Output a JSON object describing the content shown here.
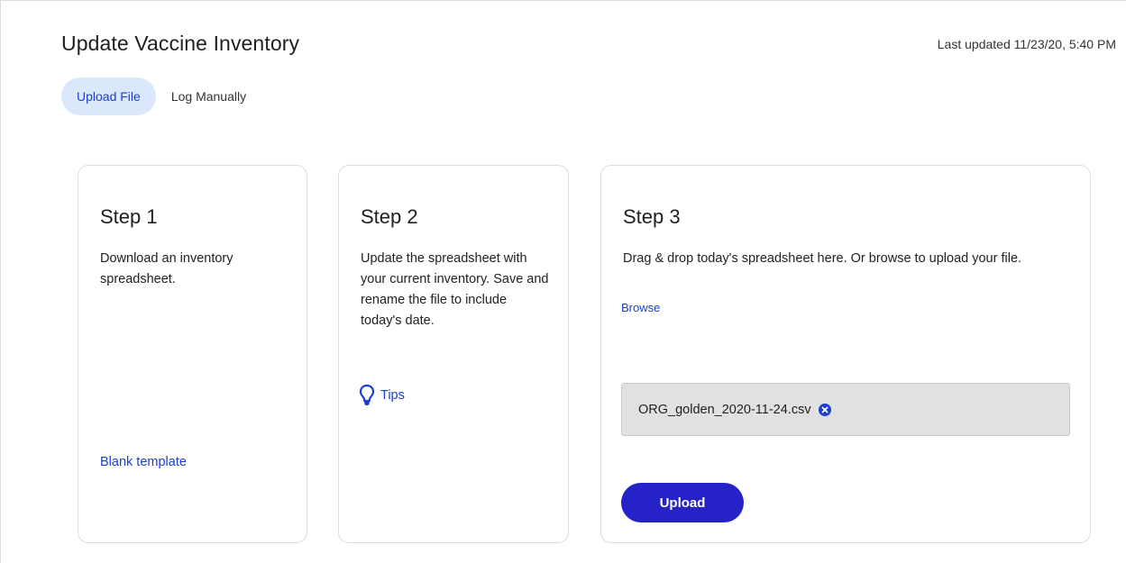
{
  "header": {
    "title": "Update Vaccine Inventory",
    "last_updated": "Last updated 11/23/20, 5:40 PM"
  },
  "tabs": [
    {
      "label": "Upload File",
      "active": true
    },
    {
      "label": "Log Manually",
      "active": false
    }
  ],
  "steps": [
    {
      "title": "Step 1",
      "description": "Download an inventory spreadsheet.",
      "link_label": "Blank template"
    },
    {
      "title": "Step 2",
      "description": "Update the spreadsheet with your current inventory. Save and rename the file to include today's date.",
      "tips_label": "Tips",
      "tips_icon": "lightbulb-icon"
    },
    {
      "title": "Step 3",
      "description": "Drag & drop today's spreadsheet here. Or browse to upload your file.",
      "browse_label": "Browse",
      "file_name": "ORG_golden_2020-11-24.csv",
      "remove_icon": "remove-circle-icon",
      "upload_label": "Upload"
    }
  ],
  "colors": {
    "accent": "#1b3fd0",
    "button": "#2523c8",
    "active_tab_bg": "#dbe8fb",
    "file_box_bg": "#e1e1e1"
  }
}
